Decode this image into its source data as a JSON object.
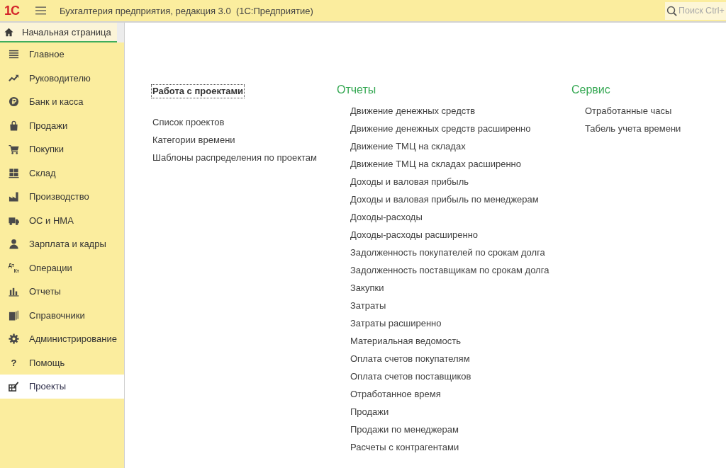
{
  "app_bar": {
    "logo": "1С",
    "title": "Бухгалтерия предприятия, редакция 3.0  (1С:Предприятие)",
    "search": {
      "placeholder": "Поиск Ctrl+"
    }
  },
  "tabs": [
    {
      "label": "Начальная страница",
      "selected": true
    }
  ],
  "sidebar": {
    "items": [
      {
        "label": "Главное",
        "selected": false
      },
      {
        "label": "Руководителю",
        "selected": false
      },
      {
        "label": "Банк и касса",
        "selected": false
      },
      {
        "label": "Продажи",
        "selected": false
      },
      {
        "label": "Покупки",
        "selected": false
      },
      {
        "label": "Склад",
        "selected": false
      },
      {
        "label": "Производство",
        "selected": false
      },
      {
        "label": "ОС и НМА",
        "selected": false
      },
      {
        "label": "Зарплата и кадры",
        "selected": false
      },
      {
        "label": "Операции",
        "icon_text": [
          "Дт",
          "Кт"
        ],
        "selected": false
      },
      {
        "label": "Отчеты",
        "selected": false
      },
      {
        "label": "Справочники",
        "selected": false
      },
      {
        "label": "Администрирование",
        "selected": false
      },
      {
        "label": "Помощь",
        "icon_text": [
          "?"
        ],
        "selected": false
      },
      {
        "label": "Проекты",
        "selected": true
      }
    ]
  },
  "content": {
    "columns": [
      {
        "kind": "group",
        "heading": "Работа с проектами",
        "items": [
          "Список проектов",
          "Категории времени",
          "Шаблоны распределения по проектам"
        ]
      },
      {
        "kind": "section",
        "heading": "Отчеты",
        "items": [
          "Движение денежных средств",
          "Движение денежных средств расширенно",
          "Движение ТМЦ на складах",
          "Движение ТМЦ на складах расширенно",
          "Доходы и валовая прибыль",
          "Доходы и валовая прибыль по менеджерам",
          "Доходы-расходы",
          "Доходы-расходы расширенно",
          "Задолженность покупателей по срокам долга",
          "Задолженность поставщикам по срокам долга",
          "Закупки",
          "Затраты",
          "Затраты расширенно",
          "Материальная ведомость",
          "Оплата счетов покупателям",
          "Оплата счетов поставщиков",
          "Отработанное время",
          "Продажи",
          "Продажи по менеджерам",
          "Расчеты с контрагентами"
        ]
      },
      {
        "kind": "section",
        "heading": "Сервис",
        "items": [
          "Отработанные часы",
          "Табель учета времени"
        ]
      }
    ]
  }
}
